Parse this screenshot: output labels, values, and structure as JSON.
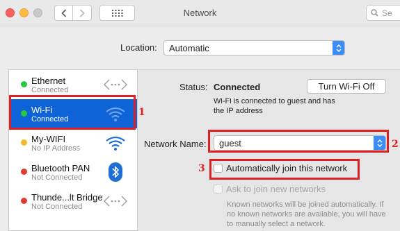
{
  "window": {
    "title": "Network",
    "search_placeholder": "Se"
  },
  "location": {
    "label": "Location:",
    "value": "Automatic"
  },
  "services": [
    {
      "name": "Ethernet",
      "status": "Connected",
      "dot_color": "#28c840",
      "icon": "ethernet-arrows-icon",
      "selected": false
    },
    {
      "name": "Wi-Fi",
      "status": "Connected",
      "dot_color": "#28c840",
      "icon": "wifi-icon",
      "selected": true
    },
    {
      "name": "My-WIFI",
      "status": "No IP Address",
      "dot_color": "#f5b82e",
      "icon": "wifi-icon",
      "selected": false
    },
    {
      "name": "Bluetooth PAN",
      "status": "Not Connected",
      "dot_color": "#e03b2f",
      "icon": "bluetooth-icon",
      "selected": false
    },
    {
      "name": "Thunde...lt Bridge",
      "status": "Not Connected",
      "dot_color": "#e03b2f",
      "icon": "thunderbolt-arrows-icon",
      "selected": false
    }
  ],
  "detail": {
    "status_label": "Status:",
    "status_value": "Connected",
    "turn_off_button": "Turn Wi-Fi Off",
    "status_desc": "Wi-Fi is connected to guest and has the IP address",
    "network_name_label": "Network Name:",
    "network_name_value": "guest",
    "auto_join_label": "Automatically join this network",
    "ask_join_label": "Ask to join new networks",
    "hint": "Known networks will be joined automatically. If no known networks are available, you will have to manually select a network."
  },
  "annotations": [
    "1",
    "2",
    "3"
  ],
  "colors": {
    "accent": "#0e63d7",
    "annotation": "#e02020",
    "connected": "#28c840",
    "no_ip": "#f5b82e",
    "not_connected": "#e03b2f"
  }
}
